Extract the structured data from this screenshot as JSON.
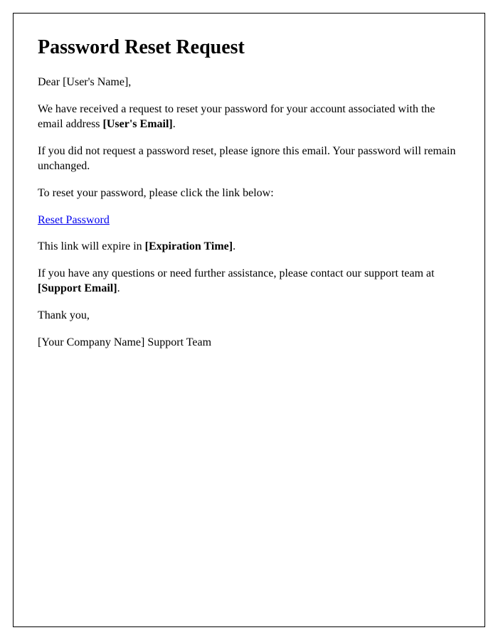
{
  "title": "Password Reset Request",
  "salutation_prefix": "Dear ",
  "user_name_placeholder": "[User's Name]",
  "salutation_suffix": ",",
  "p1_a": "We have received a request to reset your password for your account associated with the email address ",
  "user_email_placeholder": "[User's Email]",
  "p1_b": ".",
  "p2": "If you did not request a password reset, please ignore this email. Your password will remain unchanged.",
  "p3": "To reset your password, please click the link below:",
  "link_text": "Reset Password",
  "p4_a": "This link will expire in ",
  "expiration_placeholder": "[Expiration Time]",
  "p4_b": ".",
  "p5_a": "If you have any questions or need further assistance, please contact our support team at ",
  "support_email_placeholder": "[Support Email]",
  "p5_b": ".",
  "thank_you": "Thank you,",
  "signature": "[Your Company Name] Support Team"
}
